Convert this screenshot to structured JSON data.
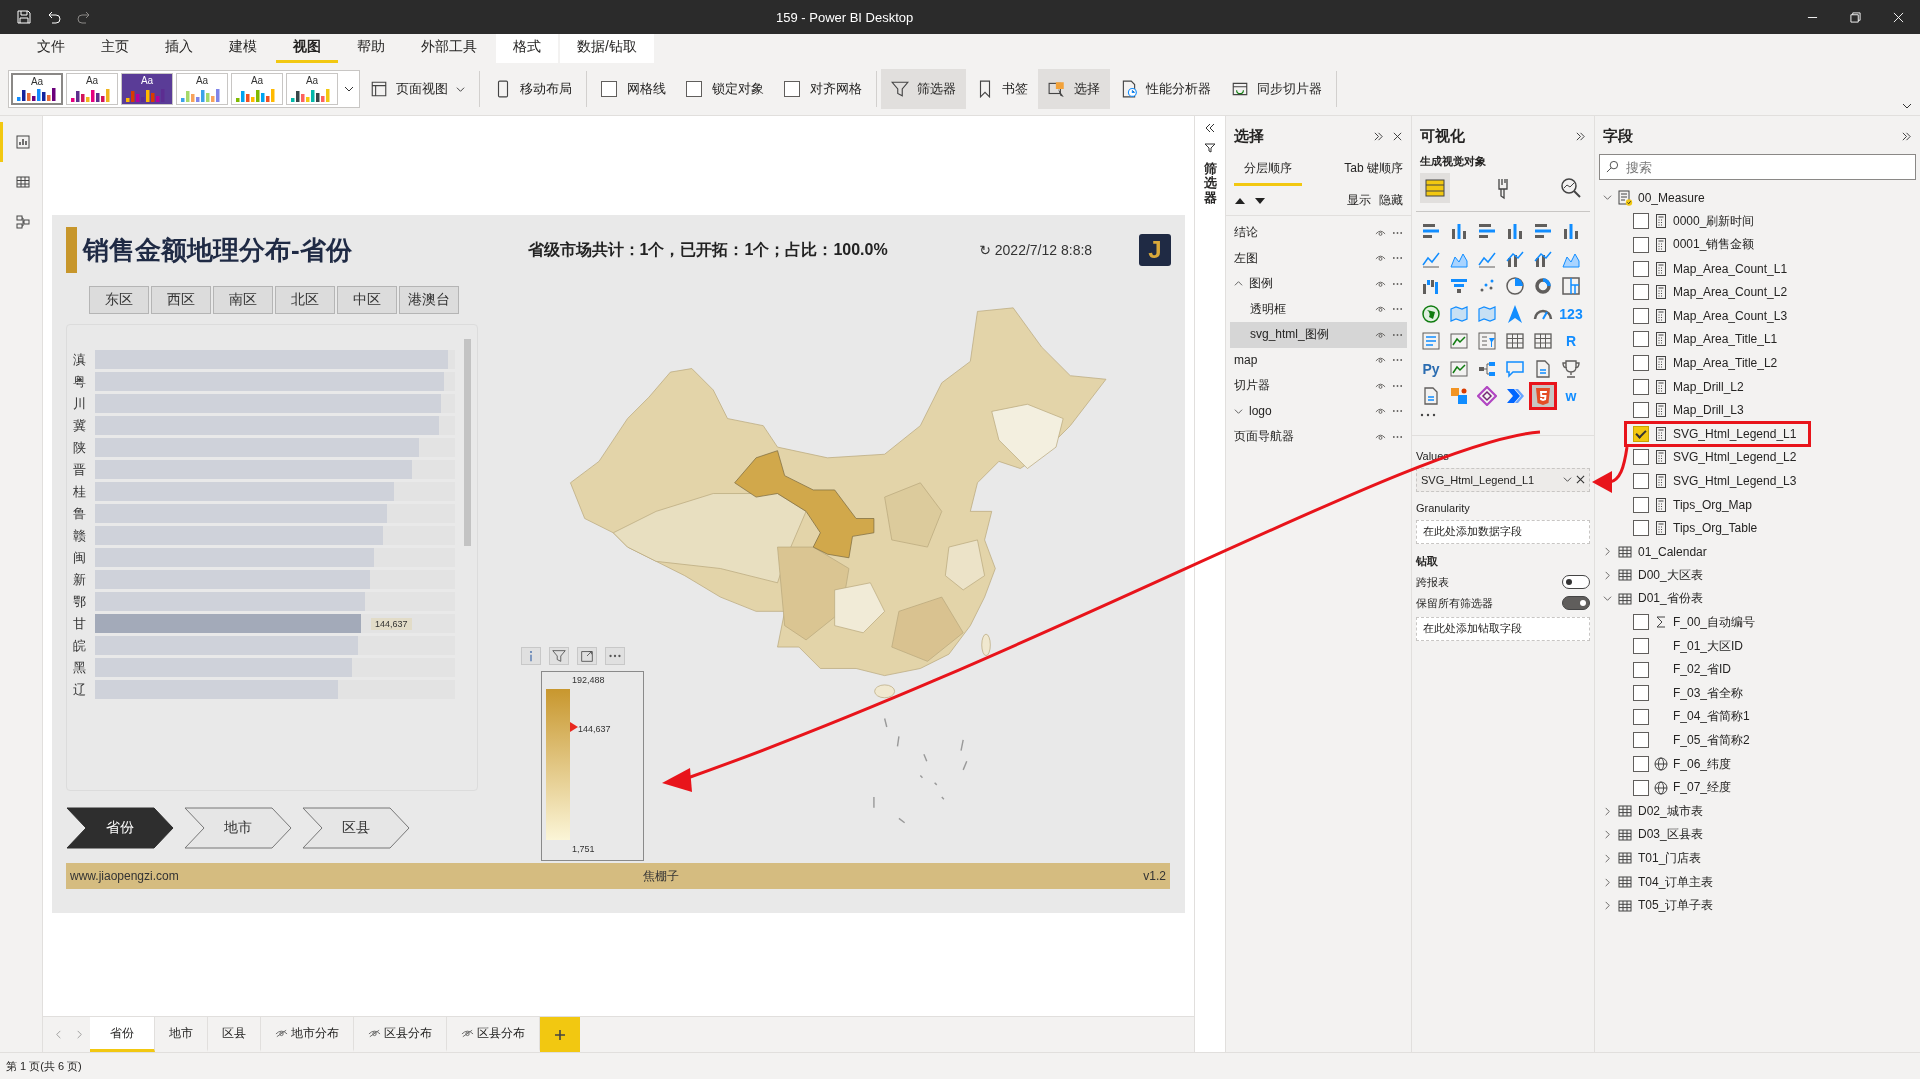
{
  "window": {
    "title": "159 - Power BI Desktop"
  },
  "menu": [
    {
      "label": "文件",
      "selected": false,
      "contextual": false
    },
    {
      "label": "主页",
      "selected": false,
      "contextual": false
    },
    {
      "label": "插入",
      "selected": false,
      "contextual": false
    },
    {
      "label": "建模",
      "selected": false,
      "contextual": false
    },
    {
      "label": "视图",
      "selected": true,
      "contextual": false
    },
    {
      "label": "帮助",
      "selected": false,
      "contextual": false
    },
    {
      "label": "外部工具",
      "selected": false,
      "contextual": false
    },
    {
      "label": "格式",
      "selected": false,
      "contextual": true
    },
    {
      "label": "数据/钻取",
      "selected": false,
      "contextual": true
    }
  ],
  "ribbon": {
    "themes": [
      {
        "label": "Aa",
        "color": "#ffffff",
        "selected": true
      },
      {
        "label": "Aa",
        "color": "#ffffff",
        "selected": false
      },
      {
        "label": "Aa",
        "color": "#5a3c97",
        "selected": false
      },
      {
        "label": "Aa",
        "color": "#ffffff",
        "selected": false
      },
      {
        "label": "Aa",
        "color": "#ffffff",
        "selected": false
      },
      {
        "label": "Aa",
        "color": "#ffffff",
        "selected": false
      }
    ],
    "items": [
      {
        "kind": "dropdown",
        "label": "页面视图"
      },
      {
        "kind": "button",
        "label": "移动布局",
        "on": false
      },
      {
        "kind": "checkbox",
        "label": "网格线",
        "checked": false
      },
      {
        "kind": "checkbox",
        "label": "锁定对象",
        "checked": false
      },
      {
        "kind": "checkbox",
        "label": "对齐网格",
        "checked": false
      },
      {
        "kind": "button",
        "label": "筛选器",
        "on": true
      },
      {
        "kind": "button",
        "label": "书签",
        "on": false
      },
      {
        "kind": "button",
        "label": "选择",
        "on": true
      },
      {
        "kind": "button",
        "label": "性能分析器",
        "on": false
      },
      {
        "kind": "button",
        "label": "同步切片器",
        "on": false
      }
    ]
  },
  "view_switcher": [
    {
      "selected": true
    },
    {
      "selected": false
    },
    {
      "selected": false
    }
  ],
  "report": {
    "title": "销售金额地理分布-省份",
    "summary": "省级市场共计：1个，已开拓：1个；占比：100.0%",
    "refresh": "↻ 2022/7/12 8:8:8",
    "logo": "J",
    "regions": [
      "东区",
      "西区",
      "南区",
      "北区",
      "中区",
      "港澳台"
    ],
    "bars": [
      {
        "label": "滇",
        "level": 0.98,
        "selected": false
      },
      {
        "label": "粤",
        "level": 0.97,
        "selected": false
      },
      {
        "label": "川",
        "level": 0.96,
        "selected": false
      },
      {
        "label": "冀",
        "level": 0.955,
        "selected": false
      },
      {
        "label": "陕",
        "level": 0.9,
        "selected": false
      },
      {
        "label": "晋",
        "level": 0.88,
        "selected": false
      },
      {
        "label": "桂",
        "level": 0.83,
        "selected": false
      },
      {
        "label": "鲁",
        "level": 0.81,
        "selected": false
      },
      {
        "label": "赣",
        "level": 0.8,
        "selected": false
      },
      {
        "label": "闽",
        "level": 0.775,
        "selected": false
      },
      {
        "label": "新",
        "level": 0.765,
        "selected": false
      },
      {
        "label": "鄂",
        "level": 0.75,
        "selected": false
      },
      {
        "label": "甘",
        "level": 0.74,
        "selected": true,
        "value": "144,637"
      },
      {
        "label": "皖",
        "level": 0.73,
        "selected": false
      },
      {
        "label": "黑",
        "level": 0.715,
        "selected": false
      },
      {
        "label": "辽",
        "level": 0.675,
        "selected": false
      }
    ],
    "legend": {
      "max": "192,488",
      "current": "144,637",
      "min": "1,751",
      "level": 0.75
    },
    "drill_levels": [
      {
        "label": "省份",
        "selected": true
      },
      {
        "label": "地市",
        "selected": false
      },
      {
        "label": "区县",
        "selected": false
      }
    ],
    "footer": {
      "left": "www.jiaopengzi.com",
      "center": "焦棚子",
      "right": "v1.2"
    }
  },
  "selection_pane": {
    "title": "选择",
    "tabs": [
      {
        "label": "分层顺序",
        "selected": true
      },
      {
        "label": "Tab 键顺序",
        "selected": false
      }
    ],
    "show": "显示",
    "hide": "隐藏",
    "layers": [
      {
        "label": "结论",
        "kind": "visual",
        "selected": false
      },
      {
        "label": "左图",
        "kind": "visual",
        "selected": false
      },
      {
        "label": "图例",
        "kind": "group",
        "selected": false,
        "expanded": true,
        "children": [
          {
            "label": "透明框",
            "kind": "visual",
            "selected": false
          },
          {
            "label": "svg_html_图例",
            "kind": "visual",
            "selected": true
          }
        ]
      },
      {
        "label": "map",
        "kind": "visual",
        "selected": false
      },
      {
        "label": "切片器",
        "kind": "visual",
        "selected": false
      },
      {
        "label": "logo",
        "kind": "group",
        "selected": false,
        "expanded": false
      },
      {
        "label": "页面导航器",
        "kind": "visual",
        "selected": false
      }
    ]
  },
  "visualizations": {
    "title": "可视化",
    "subtitle": "生成视觉对象",
    "modes": [
      {
        "selected": true
      },
      {
        "selected": false
      },
      {
        "selected": false
      }
    ],
    "types": [
      {
        "kind": "hbar",
        "selected": false
      },
      {
        "kind": "column",
        "selected": false
      },
      {
        "kind": "hbar",
        "selected": false
      },
      {
        "kind": "column",
        "selected": false
      },
      {
        "kind": "hbar",
        "selected": false
      },
      {
        "kind": "column",
        "selected": false
      },
      {
        "kind": "line",
        "selected": false
      },
      {
        "kind": "area",
        "selected": false
      },
      {
        "kind": "line",
        "selected": false
      },
      {
        "kind": "combo",
        "selected": false
      },
      {
        "kind": "combo",
        "selected": false
      },
      {
        "kind": "area",
        "selected": false
      },
      {
        "kind": "waterfall",
        "selected": false
      },
      {
        "kind": "funnel",
        "selected": false
      },
      {
        "kind": "scatter",
        "selected": false
      },
      {
        "kind": "pie",
        "selected": false
      },
      {
        "kind": "donut",
        "selected": false
      },
      {
        "kind": "treemap",
        "selected": false
      },
      {
        "kind": "globe",
        "selected": false
      },
      {
        "kind": "map",
        "selected": false
      },
      {
        "kind": "map",
        "selected": false
      },
      {
        "kind": "arrow",
        "selected": false
      },
      {
        "kind": "gauge",
        "selected": false
      },
      {
        "kind": "glyph",
        "glyph": "123",
        "selected": false
      },
      {
        "kind": "list",
        "selected": false
      },
      {
        "kind": "kpi",
        "selected": false
      },
      {
        "kind": "slicer",
        "selected": false
      },
      {
        "kind": "table",
        "selected": false
      },
      {
        "kind": "table",
        "selected": false
      },
      {
        "kind": "glyph",
        "glyph": "R",
        "selected": false
      },
      {
        "kind": "glyph",
        "glyph": "Py",
        "selected": false
      },
      {
        "kind": "kpi",
        "selected": false
      },
      {
        "kind": "tree",
        "selected": false
      },
      {
        "kind": "bubble",
        "selected": false
      },
      {
        "kind": "doc",
        "selected": false
      },
      {
        "kind": "trophy",
        "selected": false
      },
      {
        "kind": "doc",
        "selected": false
      },
      {
        "kind": "apps",
        "selected": false
      },
      {
        "kind": "diamond",
        "selected": false
      },
      {
        "kind": "chevron",
        "selected": false
      },
      {
        "kind": "html5",
        "selected": true
      },
      {
        "kind": "glyph",
        "glyph": "w",
        "selected": false
      }
    ],
    "values_label": "Values",
    "value_field": "SVG_Html_Legend_L1",
    "granularity_label": "Granularity",
    "granularity_placeholder": "在此处添加数据字段",
    "drill_label": "钻取",
    "toggles": [
      {
        "label": "跨报表",
        "on": false
      },
      {
        "label": "保留所有筛选器",
        "on": true
      }
    ],
    "drill_placeholder": "在此处添加钻取字段"
  },
  "fields_pane": {
    "title": "字段",
    "search": {
      "placeholder": "搜索"
    },
    "tables": [
      {
        "label": "00_Measure",
        "kind": "measures",
        "expanded": true,
        "children": [
          {
            "label": "0000_刷新时间",
            "kind": "measure",
            "checked": false
          },
          {
            "label": "0001_销售金额",
            "kind": "measure",
            "checked": false
          },
          {
            "label": "Map_Area_Count_L1",
            "kind": "measure",
            "checked": false
          },
          {
            "label": "Map_Area_Count_L2",
            "kind": "measure",
            "checked": false
          },
          {
            "label": "Map_Area_Count_L3",
            "kind": "measure",
            "checked": false
          },
          {
            "label": "Map_Area_Title_L1",
            "kind": "measure",
            "checked": false
          },
          {
            "label": "Map_Area_Title_L2",
            "kind": "measure",
            "checked": false
          },
          {
            "label": "Map_Drill_L2",
            "kind": "measure",
            "checked": false
          },
          {
            "label": "Map_Drill_L3",
            "kind": "measure",
            "checked": false
          },
          {
            "label": "SVG_Html_Legend_L1",
            "kind": "measure",
            "checked": true
          },
          {
            "label": "SVG_Html_Legend_L2",
            "kind": "measure",
            "checked": false
          },
          {
            "label": "SVG_Html_Legend_L3",
            "kind": "measure",
            "checked": false
          },
          {
            "label": "Tips_Org_Map",
            "kind": "measure",
            "checked": false
          },
          {
            "label": "Tips_Org_Table",
            "kind": "measure",
            "checked": false
          }
        ]
      },
      {
        "label": "01_Calendar",
        "kind": "table",
        "expanded": false
      },
      {
        "label": "D00_大区表",
        "kind": "table",
        "expanded": false
      },
      {
        "label": "D01_省份表",
        "kind": "table",
        "expanded": true,
        "children": [
          {
            "label": "F_00_自动编号",
            "kind": "sum",
            "checked": false
          },
          {
            "label": "F_01_大区ID",
            "kind": "column",
            "checked": false
          },
          {
            "label": "F_02_省ID",
            "kind": "column",
            "checked": false
          },
          {
            "label": "F_03_省全称",
            "kind": "column",
            "checked": false
          },
          {
            "label": "F_04_省简称1",
            "kind": "column",
            "checked": false
          },
          {
            "label": "F_05_省简称2",
            "kind": "column",
            "checked": false
          },
          {
            "label": "F_06_纬度",
            "kind": "geo",
            "checked": false
          },
          {
            "label": "F_07_经度",
            "kind": "geo",
            "checked": false
          }
        ]
      },
      {
        "label": "D02_城市表",
        "kind": "table",
        "expanded": false
      },
      {
        "label": "D03_区县表",
        "kind": "table",
        "expanded": false
      },
      {
        "label": "T01_门店表",
        "kind": "table",
        "expanded": false
      },
      {
        "label": "T04_订单主表",
        "kind": "table",
        "expanded": false
      },
      {
        "label": "T05_订单子表",
        "kind": "table",
        "expanded": false
      }
    ]
  },
  "filters_pane": {
    "label": "筛选器"
  },
  "page_tabs": [
    {
      "label": "省份",
      "selected": true,
      "hidden": false
    },
    {
      "label": "地市",
      "selected": false,
      "hidden": false
    },
    {
      "label": "区县",
      "selected": false,
      "hidden": false
    },
    {
      "label": "地市分布",
      "selected": false,
      "hidden": true
    },
    {
      "label": "区县分布",
      "selected": false,
      "hidden": true
    },
    {
      "label": "区县分布",
      "selected": false,
      "hidden": true
    }
  ],
  "status_bar": {
    "page": "第 1 页(共 6 页)"
  }
}
